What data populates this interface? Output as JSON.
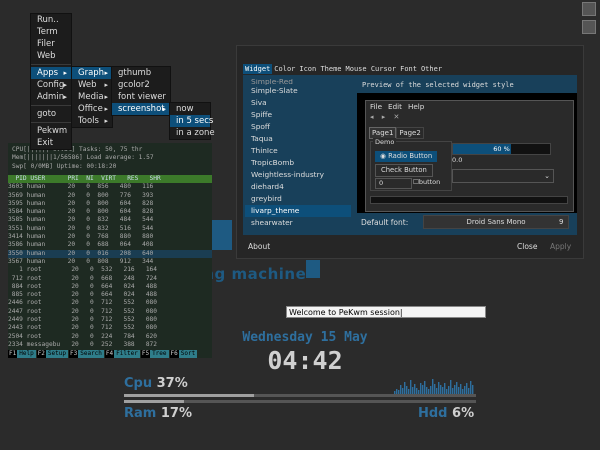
{
  "background": {
    "logo_text": "ting machine"
  },
  "top_right_icons": [
    "disk-icon",
    "window-icon"
  ],
  "htop": {
    "meters": [
      "CPU[||||||      97.3%]   Tasks: 50, 75 thr",
      "Mem[|||||||1/56586]     Load average: 1.57",
      "Swp[             0/0MB]   Uptime: 00:18:20"
    ],
    "header": "  PID USER      PRI  NI  VIRT   RES   SHR",
    "rows": [
      "3603 human      20   0  856   480   116",
      "3569 human      20   0  800   776   393",
      "3595 human      20   0  800   604   828",
      "3584 human      20   0  800   604   828",
      "3585 human      20   0  832   484   544",
      "3551 human      20   0  832   516   544",
      "3414 human      20   0  768   880   880",
      "3586 human      20   0  688   064   408",
      "3550 human      20   0  016   208   640",
      "3567 human      20   0  808   912   344",
      "   1 root        20   0  532   216   164",
      " 712 root        20   0  668   248   724",
      " 884 root        20   0  664   024   488",
      " 885 root        20   0  664   024   488",
      "2446 root        20   0  712   552   080",
      "2447 root        20   0  712   552   080",
      "2449 root        20   0  712   552   080",
      "2443 root        20   0  712   552   080",
      "2504 root        20   0  224   784   620",
      "2334 messagebu   20   0  252   388   872"
    ],
    "selected_row": 8,
    "fkeys": [
      {
        "k": "F1",
        "v": "Help"
      },
      {
        "k": "F2",
        "v": "Setup"
      },
      {
        "k": "F3",
        "v": "Search"
      },
      {
        "k": "F4",
        "v": "Filter"
      },
      {
        "k": "F5",
        "v": "Tree"
      },
      {
        "k": "F6",
        "v": "Sort"
      }
    ]
  },
  "menus": {
    "root": [
      "Run..",
      "Term",
      "Filer",
      "Web",
      "Apps",
      "Config",
      "Admin",
      "goto",
      "Pekwm",
      "Exit"
    ],
    "apps": [
      "Graph",
      "Web",
      "Media",
      "Office",
      "Tools"
    ],
    "graph": [
      "gthumb",
      "gcolor2",
      "font viewer",
      "screenshot"
    ],
    "screenshot": [
      "now",
      "in 5 secs",
      "in a zone"
    ]
  },
  "dialog": {
    "tabs": [
      "Widget",
      "Color",
      "Icon Theme",
      "Mouse Cursor",
      "Font",
      "Other"
    ],
    "themes": [
      "Simple-Red",
      "Simple-Slate",
      "Siva",
      "Spiffe",
      "Spoff",
      "Taqua",
      "ThinIce",
      "TropicBomb",
      "Weightless-industry",
      "diehard4",
      "greybird",
      "livarp_theme",
      "shearwater"
    ],
    "selected_theme": "livarp_theme",
    "preview_label": "Preview of the selected widget style",
    "preview": {
      "menu": [
        "File",
        "Edit",
        "Help"
      ],
      "toolbar": "◂ ▸ ✕",
      "tabs": [
        "Page1",
        "Page2"
      ],
      "group_title": "Demo",
      "radio_label": "Radio Button",
      "check_button": "Check Button",
      "spin_value": "0",
      "checkbox_label": "button",
      "progress_text": "60 %",
      "progress": 0.6,
      "value": "0.0"
    },
    "default_font_label": "Default font:",
    "default_font": "Droid Sans Mono",
    "font_size": "9",
    "about": "About",
    "close": "Close",
    "apply": "Apply"
  },
  "welcome": "Welcome to PeKwm session|",
  "conky": {
    "date": "Wednesday 15 May",
    "time": "04:42",
    "cpu_label": "Cpu",
    "cpu_value": "37%",
    "cpu_fraction": 0.37,
    "ram_label": "Ram",
    "ram_value": "17%",
    "ram_fraction": 0.17,
    "hdd_label": "Hdd",
    "hdd_value": "6%",
    "hdd_fraction": 0.06,
    "colors": {
      "accent": "#2e6f9e",
      "text": "#d0d0d0"
    }
  }
}
